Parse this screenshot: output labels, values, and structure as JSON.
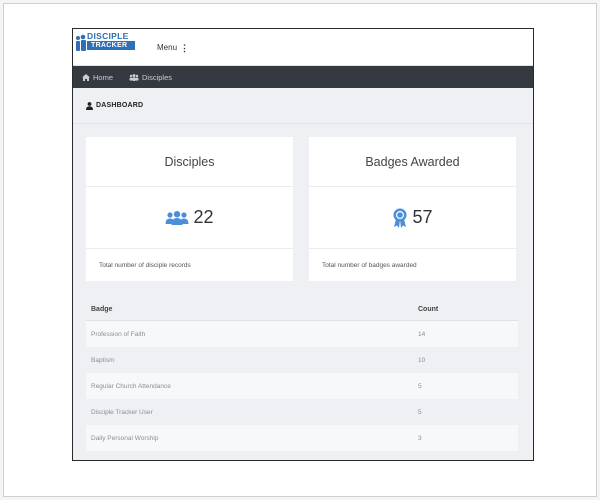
{
  "logo": {
    "line1": "DISCIPLE",
    "line2": "TRACKER"
  },
  "topbar": {
    "menu_label": "Menu"
  },
  "nav": [
    {
      "label": "Home",
      "icon": "home-icon"
    },
    {
      "label": "Disciples",
      "icon": "users-icon"
    }
  ],
  "page_title": "DASHBOARD",
  "cards": {
    "disciples": {
      "title": "Disciples",
      "value": "22",
      "footer": "Total number of disciple records",
      "icon": "users-icon"
    },
    "badges": {
      "title": "Badges Awarded",
      "value": "57",
      "footer": "Total number of badges awarded",
      "icon": "award-icon"
    }
  },
  "table": {
    "headers": {
      "badge": "Badge",
      "count": "Count"
    },
    "rows": [
      {
        "badge": "Profession of Faith",
        "count": "14"
      },
      {
        "badge": "Baptism",
        "count": "10"
      },
      {
        "badge": "Regular Church Attendance",
        "count": "5"
      },
      {
        "badge": "Disciple Tracker User",
        "count": "5"
      },
      {
        "badge": "Daily Personal Worship",
        "count": "3"
      }
    ]
  },
  "colors": {
    "navbar": "#343a40",
    "accent": "#4a90d9",
    "brand": "#2e6fb5"
  }
}
